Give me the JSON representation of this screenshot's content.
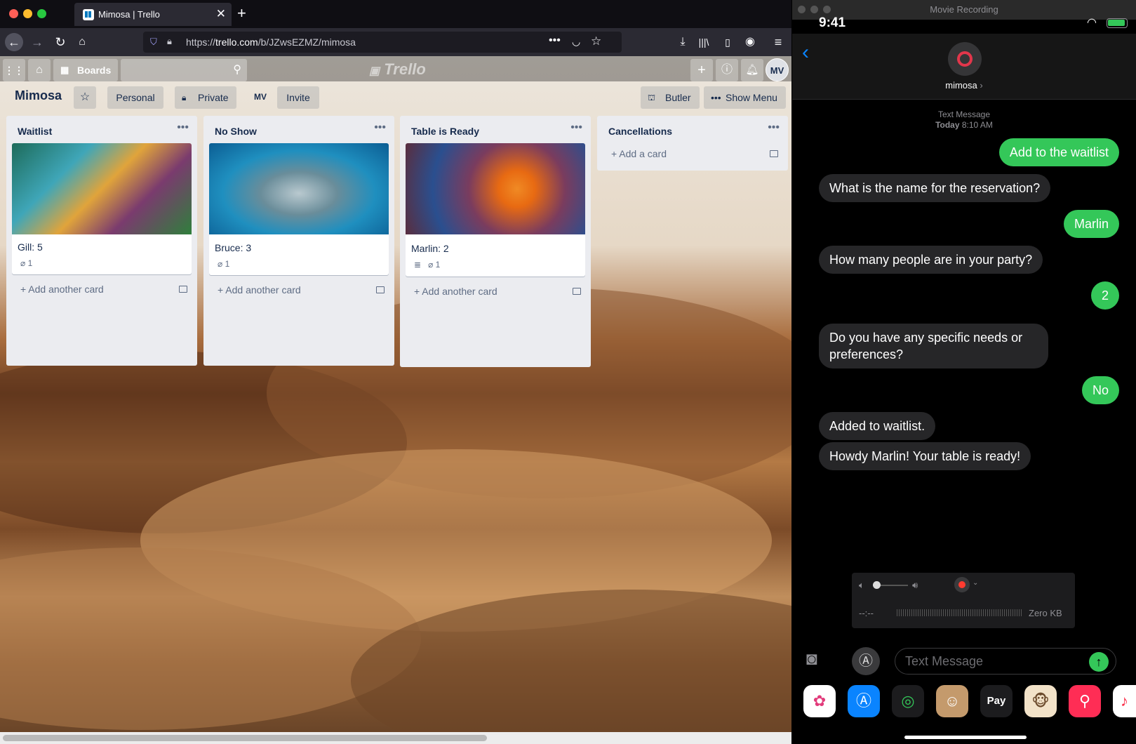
{
  "browser": {
    "tab_title": "Mimosa | Trello",
    "url_prefix": "https://",
    "url_domain": "trello.com",
    "url_path": "/b/JZwsEZMZ/mimosa"
  },
  "trello": {
    "boards_label": "Boards",
    "logo": "Trello",
    "avatar_initials": "MV",
    "board_title": "Mimosa",
    "personal_label": "Personal",
    "private_label": "Private",
    "member_initials": "MV",
    "invite_label": "Invite",
    "butler_label": "Butler",
    "show_menu_label": "Show Menu",
    "lists": [
      {
        "title": "Waitlist",
        "card_title": "Gill: 5",
        "attachments": "1",
        "add_label": "Add another card"
      },
      {
        "title": "No Show",
        "card_title": "Bruce: 3",
        "attachments": "1",
        "add_label": "Add another card"
      },
      {
        "title": "Table is Ready",
        "card_title": "Marlin: 2",
        "attachments": "1",
        "add_label": "Add another card"
      },
      {
        "title": "Cancellations",
        "add_label": "Add a card"
      }
    ]
  },
  "phone": {
    "window_title": "Movie Recording",
    "time": "9:41",
    "contact_name": "mimosa",
    "thread_label": "Text Message",
    "thread_day": "Today",
    "thread_time": "8:10 AM",
    "messages": [
      {
        "dir": "out",
        "text": "Add to the waitlist"
      },
      {
        "dir": "in",
        "text": "What is the name for the reservation?"
      },
      {
        "dir": "out",
        "text": "Marlin"
      },
      {
        "dir": "in",
        "text": "How many people are in your party?"
      },
      {
        "dir": "out",
        "text": "2"
      },
      {
        "dir": "in",
        "text": "Do you have any specific needs or preferences?"
      },
      {
        "dir": "out",
        "text": "No"
      },
      {
        "dir": "in",
        "text": "Added to waitlist."
      },
      {
        "dir": "in",
        "text": "Howdy Marlin! Your table is ready!"
      }
    ],
    "recorder": {
      "duration": "--:--",
      "size": "Zero KB"
    },
    "input_placeholder": "Text Message",
    "apple_pay_label": "Pay"
  }
}
